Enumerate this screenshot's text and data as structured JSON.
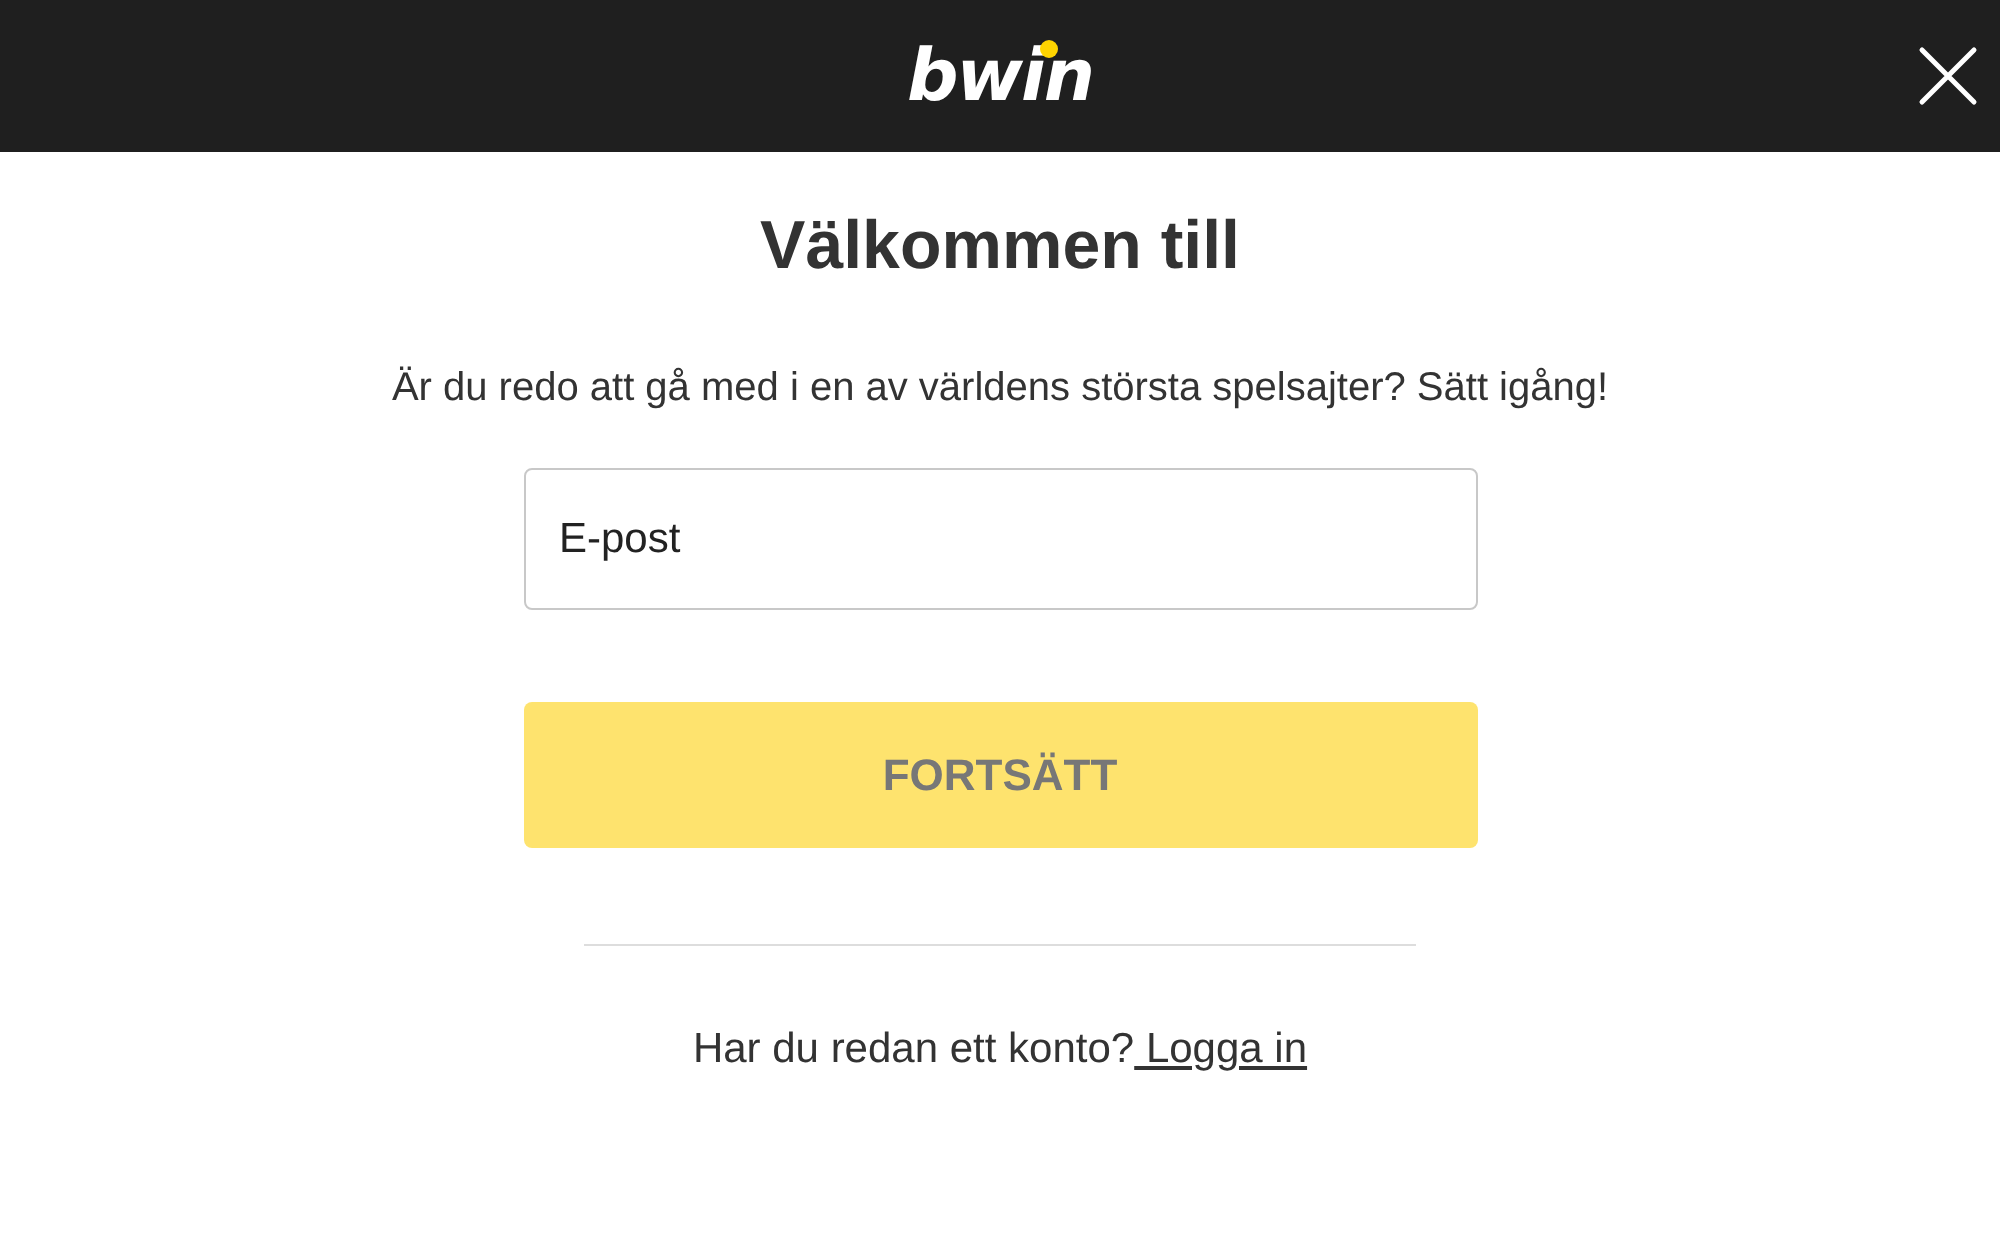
{
  "header": {
    "logo": "bwin"
  },
  "title": "Välkommen till",
  "subtitle": "Är du redo att gå med i en av världens största spelsajter? Sätt igång!",
  "email_field": {
    "placeholder": "E-post"
  },
  "continue_button": {
    "label": "FORTSÄTT",
    "disabled": true
  },
  "footer": {
    "text": "Har du redan ett konto?",
    "link": " Logga in"
  }
}
